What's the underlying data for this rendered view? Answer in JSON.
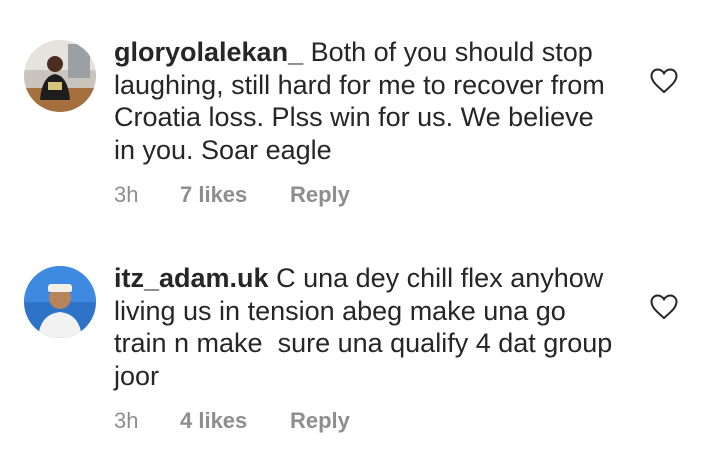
{
  "comments": [
    {
      "username": "gloryolalekan_",
      "text": "Both of you should stop laughing, still hard for me to recover from Croatia loss. Plss win for us. We believe in you. Soar eagle",
      "time": "3h",
      "likes": "7 likes",
      "reply": "Reply",
      "avatar_icon": "user-avatar-photo",
      "like_icon": "heart-outline-icon"
    },
    {
      "username": "itz_adam.uk",
      "text": "C una dey chill flex anyhow living us in tension abeg make una go train n make  sure una qualify 4 dat group joor",
      "time": "3h",
      "likes": "4 likes",
      "reply": "Reply",
      "avatar_icon": "user-avatar-photo",
      "like_icon": "heart-outline-icon"
    }
  ],
  "colors": {
    "text": "#262626",
    "meta": "#8e8e8e"
  }
}
